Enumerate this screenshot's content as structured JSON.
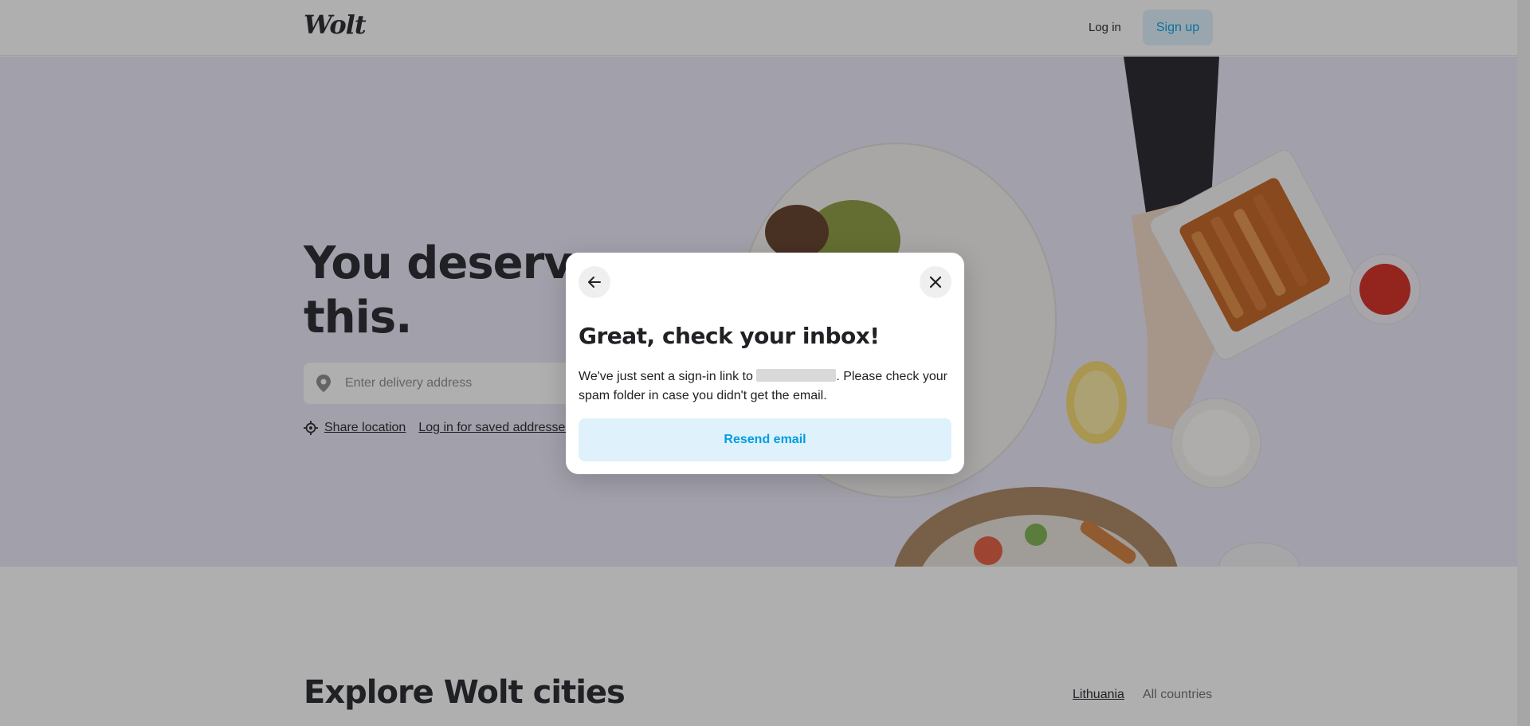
{
  "header": {
    "logo": "Wolt",
    "login_label": "Log in",
    "signup_label": "Sign up"
  },
  "hero": {
    "title": "You deserve this.",
    "address_placeholder": "Enter delivery address",
    "share_location_label": "Share location",
    "saved_addresses_label": "Log in for saved addresses"
  },
  "explore": {
    "title": "Explore Wolt cities",
    "tabs": [
      "Lithuania",
      "All countries"
    ]
  },
  "modal": {
    "title": "Great, check your inbox!",
    "message_prefix": "We've just sent a sign-in link to",
    "message_suffix": ". Please check your spam folder in case you didn't get the email.",
    "resend_label": "Resend email"
  },
  "icons": {
    "back": "arrow-left-icon",
    "close": "close-icon",
    "pin": "location-pin-icon",
    "crosshair": "crosshair-icon"
  },
  "colors": {
    "brand_blue": "#009de0",
    "brand_blue_light": "#dff1fb",
    "hero_bg": "#ebe8f6",
    "text": "#202125"
  }
}
